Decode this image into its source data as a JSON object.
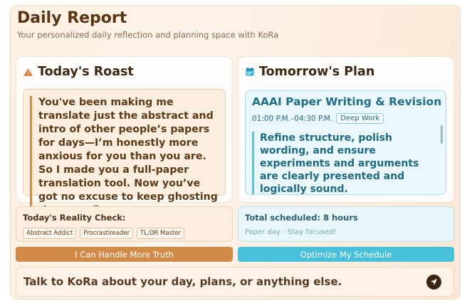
{
  "header": {
    "title": "Daily Report",
    "subtitle": "Your personalized daily reflection and planning space with KoRa"
  },
  "roast": {
    "heading": "Today's Roast",
    "icon": "warning-icon",
    "text": "You've been making me translate just the abstract and intro of other people’s papers for days—I’m honestly more anxious for you than you are. So I made you a full-paper translation tool. Now you’ve got no excuse to keep ghosting the rest. 😏"
  },
  "plan": {
    "heading": "Tomorrow's Plan",
    "icon": "calendar-icon",
    "item": {
      "title": "AAAI Paper Writing & Revision",
      "time": "01:00 P.M.–04:30 P.M.",
      "tag": "Deep Work",
      "description": "Refine structure, polish wording, and ensure experiments and arguments are clearly presented and logically sound."
    }
  },
  "reality_check": {
    "label": "Today's Reality Check:",
    "badges": [
      "Abstract Addict",
      "Procrastireader",
      "TL;DR Master"
    ]
  },
  "schedule": {
    "total": "Total scheduled: 8 hours",
    "note": "Paper day - Stay focused!"
  },
  "buttons": {
    "truth": "I Can Handle More Truth",
    "optimize": "Optimize My Schedule"
  },
  "chat": {
    "placeholder": "Talk to KoRa about your day, plans, or anything else.",
    "send_icon": "send-icon"
  },
  "colors": {
    "accent_orange": "#d28a48",
    "accent_cyan": "#48c0d9",
    "title_brown": "#5a3513"
  }
}
